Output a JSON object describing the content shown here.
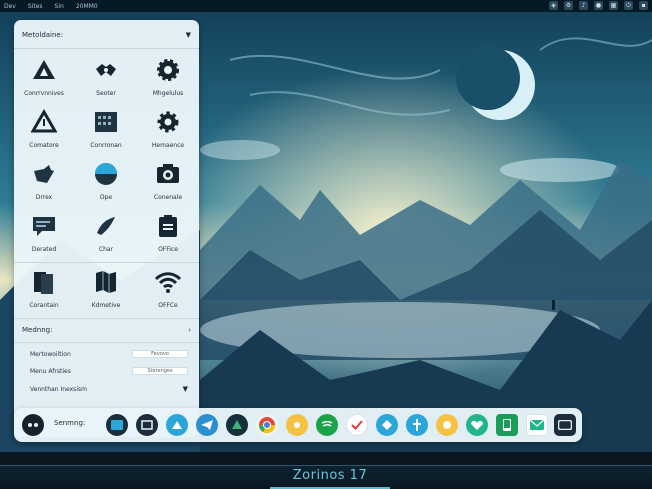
{
  "topbar": {
    "menus": [
      "Dev",
      "Sites",
      "Sin",
      "20MM0"
    ]
  },
  "launcher": {
    "header": "Metoldaine:",
    "apps": [
      {
        "label": "Conrrvnnives",
        "icon": "triangle-warning-icon"
      },
      {
        "label": "Seoter",
        "icon": "handshake-icon"
      },
      {
        "label": "Mhgelulus",
        "icon": "gear-icon"
      },
      {
        "label": "Comatore",
        "icon": "alert-triangle-icon"
      },
      {
        "label": "Conrronan",
        "icon": "keyboard-icon"
      },
      {
        "label": "Hemaence",
        "icon": "cog-icon"
      },
      {
        "label": "Drrex",
        "icon": "bird-icon"
      },
      {
        "label": "Ope",
        "icon": "pie-chart-icon"
      },
      {
        "label": "Conenale",
        "icon": "camera-icon"
      },
      {
        "label": "Derated",
        "icon": "chat-card-icon"
      },
      {
        "label": "Char",
        "icon": "bird-chat-icon"
      },
      {
        "label": "OFFice",
        "icon": "clipboard-icon"
      },
      {
        "label": "Corantain",
        "icon": "documents-icon"
      },
      {
        "label": "Kdmetive",
        "icon": "map-icon"
      },
      {
        "label": "OFFCe",
        "icon": "wifi-icon"
      }
    ],
    "settings": {
      "title": "Mednng:",
      "rows": [
        {
          "label": "Mertowoiltion",
          "value": "Fevovo"
        },
        {
          "label": "Menu Afrsties",
          "value": "Sterenges"
        },
        {
          "label": "Vennthan Inexsism",
          "value": ""
        }
      ]
    }
  },
  "dock": {
    "label": "Senmng:"
  },
  "brand": "Zorinos 17",
  "colors": {
    "accent": "#2aa7d8",
    "brand_text": "#69c6d8"
  }
}
